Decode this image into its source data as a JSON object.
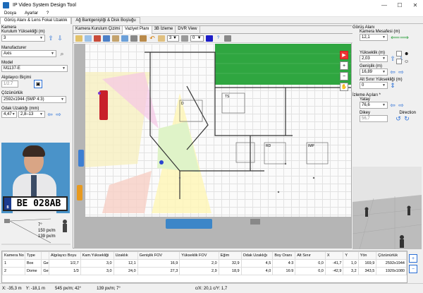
{
  "window": {
    "title": "IP Video System Design Tool",
    "min": "—",
    "max": "☐",
    "close": "✕"
  },
  "menu": [
    "Dosya",
    "Ayarlar",
    "?"
  ],
  "main_tabs": [
    "Görüş Alanı & Lens Fokal Uzaklık",
    "Ağ Bantgenişliği & Disk Boşluğu"
  ],
  "left": {
    "camera_label": "Kamera",
    "mount_height_label": "Kurulum Yüksekliği (m)",
    "mount_height": "3",
    "manufacturer_label": "Manufacturer",
    "manufacturer": "Axis",
    "model_label": "Model",
    "model": "M1137-E",
    "sensor_label": "Algılayıcı Biçimi",
    "sensor": "1/2.7",
    "resolution_label": "Çözünürlük",
    "resolution": "2592x1944 (5MP 4:3)",
    "focal_label": "Odak Uzaklığı (mm)",
    "focal": "4,47",
    "focal_range": "2,8–13",
    "plate_text": "BE 028AB",
    "plate_country": "B",
    "angle": "7°",
    "density_h": "150 px/m",
    "density_v": "139 px/m"
  },
  "view_tabs": [
    "Kamera Kurulum Çizimi",
    "Vaziyet Planı",
    "3B İzleme",
    "DVR View"
  ],
  "toolbar": {
    "level": "3",
    "rotation": "0",
    "help": "?"
  },
  "plan_labels": [
    "D",
    "TS",
    "RD",
    "IMP"
  ],
  "right": {
    "fov_group": "Görüş Alanı",
    "distance_label": "Kamera Mesafesi (m)",
    "distance": "12,1",
    "height_label": "Yükseklik (m)",
    "height": "2,03",
    "width_label": "Genişlik (m)",
    "width": "16,89",
    "lower_label": "Alt Sınır Yüksekliği (m)",
    "lower": "0",
    "view_group": "İzleme Açıları *",
    "horizontal_label": "Yatay",
    "horizontal": "76,6",
    "vertical_label": "Dikey",
    "vertical": "56,7",
    "direction_label": "Direction"
  },
  "table": {
    "headers": [
      "Kamera No",
      "Type",
      "",
      "Algılayıcı Boyu",
      "Kam.Yüksekliği",
      "Uzaklık",
      "Genişlik FOV",
      "Yükseklik FOV",
      "Eğim",
      "Odak Uzaklığı",
      "Boy Oranı",
      "Alt Sınır",
      "X",
      "Y",
      "Yön",
      "Çözünürlük"
    ],
    "rows": [
      [
        "1",
        "Box",
        "Ge",
        "1/2,7",
        "3,0",
        "12,1",
        "16,9",
        "2,0",
        "32,9",
        "4,5",
        "4:3",
        "0,0",
        "-41,7",
        "1,0",
        "169,9",
        "2592x1944"
      ],
      [
        "2",
        "Dome",
        "Ge",
        "1/3",
        "3,0",
        "24,0",
        "27,3",
        "2,9",
        "18,9",
        "4,0",
        "16:9",
        "0,0",
        "-42,9",
        "3,2",
        "343,5",
        "1920x1080"
      ]
    ]
  },
  "status": {
    "x": "X: -35,3 m",
    "y": "Y: -18,1 m",
    "res": "545 px/m; 42°",
    "res2": "139 px/m; 7°",
    "coord": "c/X: 20,1 c/Y: 1,7"
  }
}
